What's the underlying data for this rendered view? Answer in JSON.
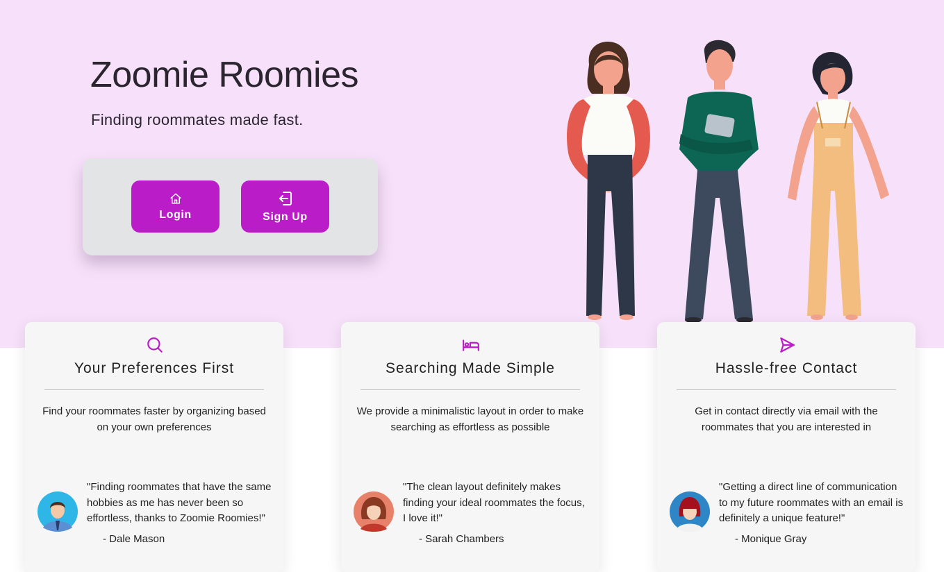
{
  "hero": {
    "title": "Zoomie Roomies",
    "tagline": "Finding roommates made fast."
  },
  "auth": {
    "login": {
      "label": "Login",
      "icon": "home-icon"
    },
    "signup": {
      "label": "Sign Up",
      "icon": "sign-in-icon"
    }
  },
  "colors": {
    "hero_bg": "#f7e1fa",
    "accent": "#ba1dc7",
    "panel_bg": "#e3e4e6",
    "card_bg": "#f6f6f7"
  },
  "features": [
    {
      "icon": "search-icon",
      "title": "Your Preferences First",
      "description": "Find your roommates faster by organizing based on your own preferences",
      "quote": "\"Finding roommates that have the same hobbies as me has never been so effortless, thanks to Zoomie Roomies!\"",
      "author": "- Dale Mason",
      "avatar": "man-avatar"
    },
    {
      "icon": "bed-icon",
      "title": "Searching Made Simple",
      "description": "We provide a minimalistic layout in order to make searching as effortless as possible",
      "quote": "\"The clean layout definitely makes finding your ideal roommates the focus, I love it!\"",
      "author": "- Sarah Chambers",
      "avatar": "woman-curly-hair-avatar"
    },
    {
      "icon": "send-icon",
      "title": "Hassle-free Contact",
      "description": "Get in contact directly via email with the roommates that you are interested in",
      "quote": "\"Getting a direct line of communication to my future roommates with an email is definitely a unique feature!\"",
      "author": "- Monique Gray",
      "avatar": "woman-red-hair-avatar"
    }
  ]
}
